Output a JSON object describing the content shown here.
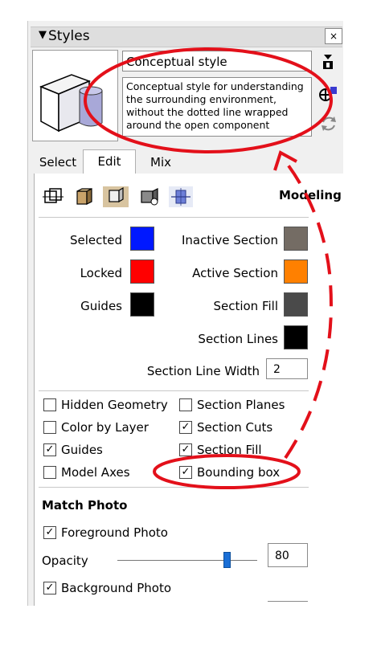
{
  "panel": {
    "title": "Styles",
    "collapse_glyph": "▼",
    "close_glyph": "×"
  },
  "style": {
    "name": "Conceptual style",
    "description": "Conceptual style for understanding the surrounding environment, without the dotted line wrapped around the open component"
  },
  "tabs": [
    {
      "label": "Select"
    },
    {
      "label": "Edit"
    },
    {
      "label": "Mix"
    }
  ],
  "edit": {
    "category_title": "Modeling",
    "colors": [
      {
        "label": "Selected",
        "color": "#0018ff"
      },
      {
        "label": "Locked",
        "color": "#ff0000"
      },
      {
        "label": "Guides",
        "color": "#000000"
      },
      {
        "label": "Inactive Section",
        "color": "#746c64"
      },
      {
        "label": "Active Section",
        "color": "#ff8000"
      },
      {
        "label": "Section Fill",
        "color": "#4a4a4a"
      },
      {
        "label": "Section Lines",
        "color": "#000000"
      }
    ],
    "section_line_width_label": "Section Line Width",
    "section_line_width": "2",
    "checkboxes": [
      {
        "label": "Hidden Geometry",
        "checked": false
      },
      {
        "label": "Color by Layer",
        "checked": false
      },
      {
        "label": "Guides",
        "checked": true
      },
      {
        "label": "Model Axes",
        "checked": false
      },
      {
        "label": "Section Planes",
        "checked": false
      },
      {
        "label": "Section Cuts",
        "checked": true
      },
      {
        "label": "Section Fill",
        "checked": true
      },
      {
        "label": "Bounding box",
        "checked": true
      }
    ],
    "match_photo_title": "Match Photo",
    "foreground_photo_label": "Foreground Photo",
    "foreground_photo_checked": true,
    "opacity_label": "Opacity",
    "opacity_value": "80",
    "background_photo_label": "Background Photo",
    "background_photo_checked": true
  },
  "annotation_color": "#e3101a"
}
